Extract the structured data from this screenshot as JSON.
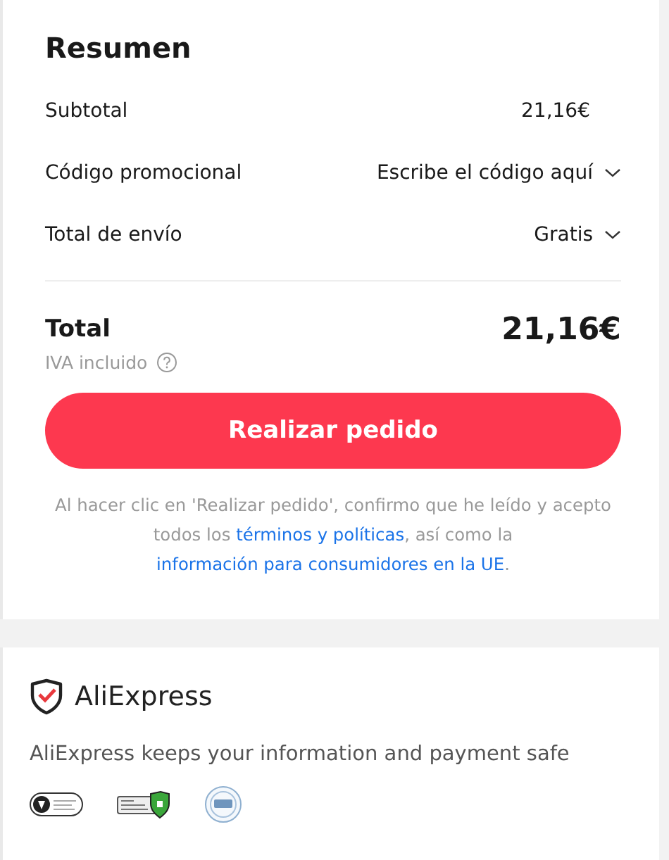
{
  "summary": {
    "title": "Resumen",
    "rows": [
      {
        "label": "Subtotal",
        "value": "21,16€",
        "kind": "plain"
      },
      {
        "label": "Código promocional",
        "value": "Escribe el código aquí",
        "kind": "dropdown"
      },
      {
        "label": "Total de envío",
        "value": "Gratis",
        "kind": "dropdown"
      }
    ],
    "total": {
      "label": "Total",
      "value": "21,16€",
      "tax_note": "IVA incluido"
    },
    "button": "Realizar pedido",
    "legal": [
      {
        "kind": "text",
        "text": "Al hacer clic en 'Realizar pedido', confirmo que he leído y acepto todos los "
      },
      {
        "kind": "link",
        "text": "términos y políticas"
      },
      {
        "kind": "text",
        "text": ", así como la "
      },
      {
        "kind": "link",
        "text": "información para consumidores en la UE"
      },
      {
        "kind": "text",
        "text": "."
      }
    ]
  },
  "trust": {
    "brand": "AliExpress",
    "tagline": "AliExpress keeps your information and payment safe"
  }
}
